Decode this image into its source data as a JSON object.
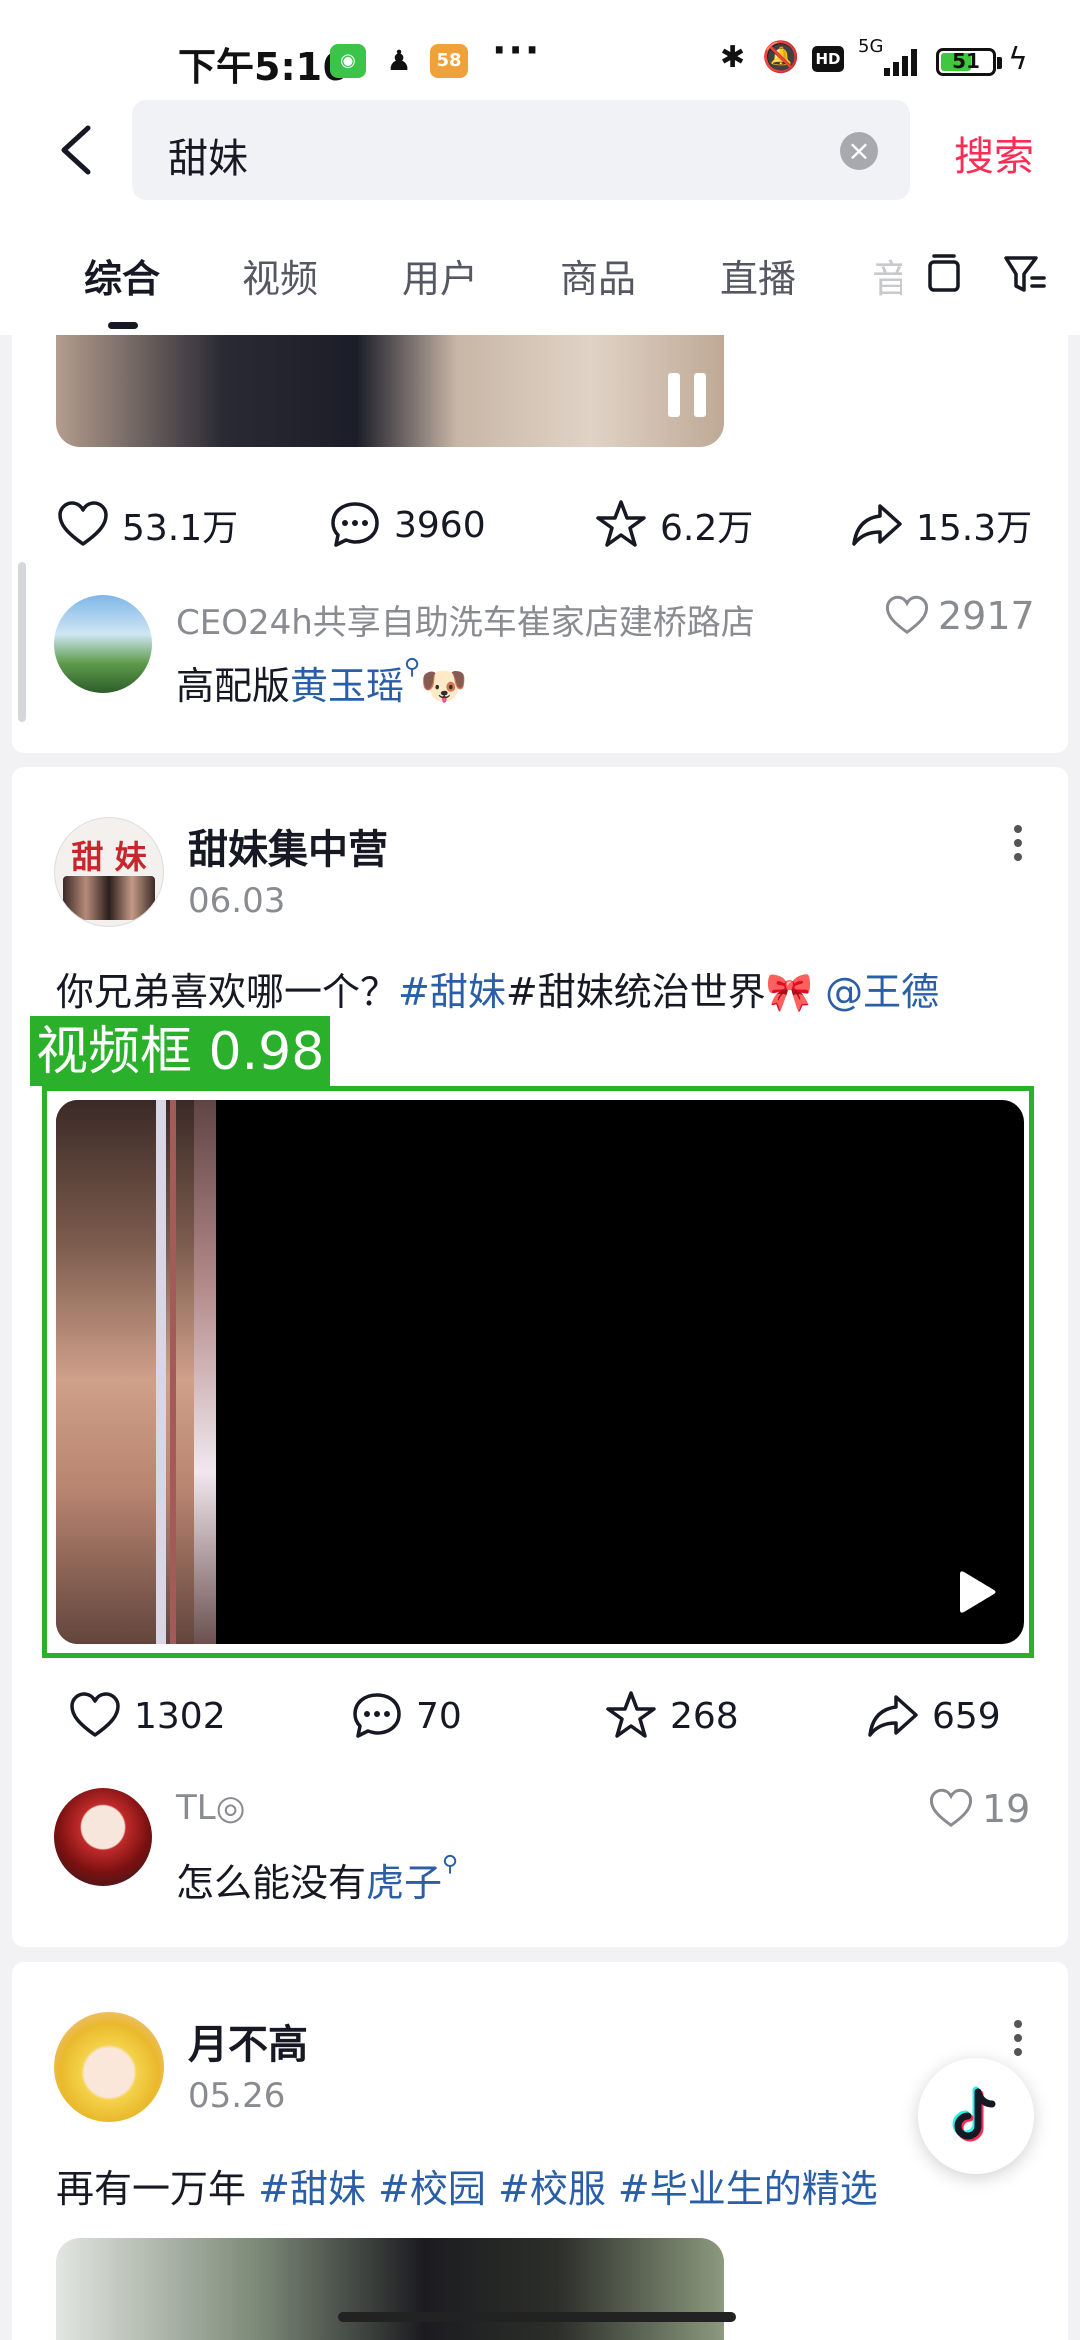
{
  "status_bar": {
    "time": "下午5:16",
    "network": "5G",
    "battery_level": "51"
  },
  "search": {
    "query": "甜妹",
    "search_label": "搜索"
  },
  "tabs": {
    "items": [
      "综合",
      "视频",
      "用户",
      "商品",
      "直播"
    ],
    "faded": "音",
    "active": "综合"
  },
  "post1": {
    "actions": {
      "likes": "53.1万",
      "comments": "3960",
      "favorites": "6.2万",
      "shares": "15.3万"
    },
    "comment": {
      "user": "CEO24h共享自助洗车崔家店建桥路店",
      "text_plain": "高配版",
      "text_link": "黄玉瑶",
      "likes": "2917"
    }
  },
  "post2": {
    "author": "甜妹集中营",
    "avatar_text": "甜 妹",
    "date": "06.03",
    "caption_plain": "你兄弟喜欢哪一个？",
    "caption_tag1": "#甜妹",
    "caption_tag2": "#甜妹统治世界",
    "caption_mention": "@王德",
    "detection_label": "视频框 0.98",
    "actions": {
      "likes": "1302",
      "comments": "70",
      "favorites": "268",
      "shares": "659"
    },
    "comment": {
      "user": "TL◎",
      "text_plain": "怎么能没有",
      "text_link": "虎子",
      "likes": "19"
    }
  },
  "post3": {
    "author": "月不高",
    "date": "05.26",
    "caption_plain": "再有一万年",
    "caption_tags": [
      "#甜妹",
      "#校园",
      "#校服",
      "#毕业生的精选"
    ]
  },
  "colors": {
    "accent": "#fe2c55",
    "link": "#2a5ea6",
    "detection": "#2bb02b"
  }
}
